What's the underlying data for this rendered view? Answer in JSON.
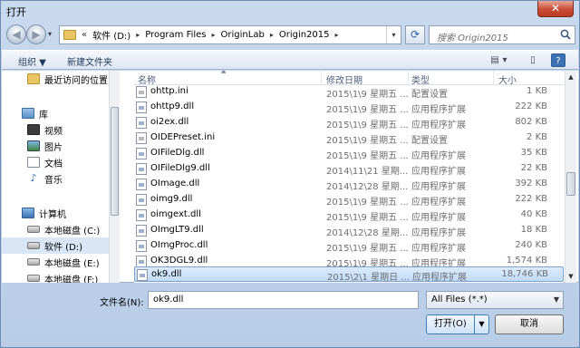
{
  "window": {
    "title": "打开",
    "close_glyph": "✕"
  },
  "nav": {
    "back_glyph": "◀",
    "forward_glyph": "▶",
    "recent_glyph": "▾",
    "breadcrumb": [
      {
        "label": "软件 (D:)"
      },
      {
        "label": "Program Files"
      },
      {
        "label": "OriginLab"
      },
      {
        "label": "Origin2015"
      }
    ],
    "chevron": "«",
    "crumb_arrow": "▸",
    "dropdown_glyph": "▾",
    "refresh_glyph": "⟳",
    "search_placeholder": "搜索 Origin2015"
  },
  "toolbar": {
    "organize": "组织 ▼",
    "new_folder": "新建文件夹",
    "view_glyph": "▤",
    "view_drop": "▾",
    "pane_glyph": "▯",
    "help_glyph": "?"
  },
  "sidebar": {
    "items": [
      {
        "label": "最近访问的位置",
        "icon": "folder"
      },
      {
        "label": "库",
        "icon": "library"
      },
      {
        "label": "视频",
        "icon": "video"
      },
      {
        "label": "图片",
        "icon": "pictures"
      },
      {
        "label": "文档",
        "icon": "documents"
      },
      {
        "label": "音乐",
        "icon": "music"
      },
      {
        "label": "计算机",
        "icon": "computer"
      },
      {
        "label": "本地磁盘 (C:)",
        "icon": "drive"
      },
      {
        "label": "软件 (D:)",
        "icon": "drive"
      },
      {
        "label": "本地磁盘 (E:)",
        "icon": "drive"
      },
      {
        "label": "本地磁盘 (F:)",
        "icon": "drive"
      }
    ]
  },
  "files": {
    "columns": {
      "name": "名称",
      "date": "修改日期",
      "type": "类型",
      "size": "大小"
    },
    "sort_glyph": "▲",
    "rows": [
      {
        "name": "ohttp.ini",
        "date": "2015\\1\\9 星期五 ...",
        "type": "配置设置",
        "size": "1 KB"
      },
      {
        "name": "ohttp9.dll",
        "date": "2015\\1\\9 星期五 ...",
        "type": "应用程序扩展",
        "size": "222 KB"
      },
      {
        "name": "oi2ex.dll",
        "date": "2015\\1\\9 星期五 ...",
        "type": "应用程序扩展",
        "size": "802 KB"
      },
      {
        "name": "OIDEPreset.ini",
        "date": "2015\\1\\9 星期五 ...",
        "type": "配置设置",
        "size": "2 KB"
      },
      {
        "name": "OIFileDlg.dll",
        "date": "2015\\1\\9 星期五 ...",
        "type": "应用程序扩展",
        "size": "35 KB"
      },
      {
        "name": "OIFileDlg9.dll",
        "date": "2014\\11\\21 星期...",
        "type": "应用程序扩展",
        "size": "22 KB"
      },
      {
        "name": "OImage.dll",
        "date": "2014\\12\\28 星期...",
        "type": "应用程序扩展",
        "size": "392 KB"
      },
      {
        "name": "oimg9.dll",
        "date": "2015\\1\\9 星期五 ...",
        "type": "应用程序扩展",
        "size": "222 KB"
      },
      {
        "name": "oimgext.dll",
        "date": "2015\\1\\9 星期五 ...",
        "type": "应用程序扩展",
        "size": "40 KB"
      },
      {
        "name": "OImgLT9.dll",
        "date": "2014\\12\\28 星期...",
        "type": "应用程序扩展",
        "size": "18 KB"
      },
      {
        "name": "OImgProc.dll",
        "date": "2015\\1\\9 星期五 ...",
        "type": "应用程序扩展",
        "size": "240 KB"
      },
      {
        "name": "OK3DGL9.dll",
        "date": "2015\\1\\9 星期五 ...",
        "type": "应用程序扩展",
        "size": "1,574 KB"
      },
      {
        "name": "ok9.dll",
        "date": "2015\\2\\1 星期日 ...",
        "type": "应用程序扩展",
        "size": "18,746 KB",
        "selected": true
      }
    ]
  },
  "bottom": {
    "filename_label": "文件名(N):",
    "filename_value": "ok9.dll",
    "filter_value": "All Files (*.*)",
    "filter_arrow": "▼",
    "open_label": "打开(O)",
    "open_split": "▼",
    "cancel_label": "取消"
  }
}
